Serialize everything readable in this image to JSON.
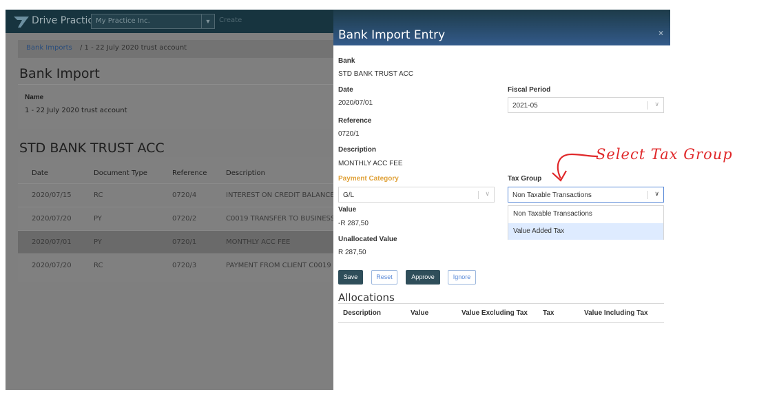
{
  "app": {
    "brand": "Drive Practice",
    "org_select": "My Practice Inc.",
    "create": "Create",
    "breadcrumb": {
      "link": "Bank Imports",
      "rest": "/ 1 - 22 July 2020 trust account"
    },
    "heading": "Bank Import",
    "name_label": "Name",
    "name_value": "1 - 22 July 2020 trust account",
    "bank_heading": "STD BANK TRUST ACC",
    "table": {
      "headers": [
        "Date",
        "Document Type",
        "Reference",
        "Description"
      ],
      "rows": [
        [
          "2020/07/15",
          "RC",
          "0720/4",
          "INTEREST ON CREDIT BALANCE"
        ],
        [
          "2020/07/20",
          "PY",
          "0720/2",
          "C0019 TRANSFER TO BUSINESS"
        ],
        [
          "2020/07/01",
          "PY",
          "0720/1",
          "MONTHLY ACC FEE"
        ],
        [
          "2020/07/20",
          "RC",
          "0720/3",
          "PAYMENT FROM CLIENT C0019"
        ]
      ]
    }
  },
  "panel": {
    "title": "Bank Import Entry",
    "close": "×",
    "bank_label": "Bank",
    "bank_value": "STD BANK TRUST ACC",
    "date_label": "Date",
    "date_value": "2020/07/01",
    "fiscal_label": "Fiscal Period",
    "fiscal_value": "2021-05",
    "reference_label": "Reference",
    "reference_value": "0720/1",
    "description_label": "Description",
    "description_value": "MONTHLY ACC FEE",
    "payment_category_label": "Payment Category",
    "payment_category_value": "G/L",
    "tax_group_label": "Tax Group",
    "tax_group_value": "Non Taxable Transactions",
    "tax_group_options": [
      "Non Taxable Transactions",
      "Value Added Tax"
    ],
    "value_label": "Value",
    "value_value": "-R 287,50",
    "unallocated_label": "Unallocated Value",
    "unallocated_value": "R 287,50",
    "buttons": {
      "save": "Save",
      "reset": "Reset",
      "approve": "Approve",
      "ignore": "Ignore"
    },
    "allocations_title": "Allocations",
    "allocations_headers": [
      "Description",
      "Value",
      "Value Excluding Tax",
      "Tax",
      "Value Including Tax"
    ]
  },
  "annotation": "Select Tax Group",
  "colors": {
    "topbar": "#17343f",
    "accent": "#2f4e5a",
    "annotation": "#e0282a",
    "highlight": "#deebff"
  }
}
